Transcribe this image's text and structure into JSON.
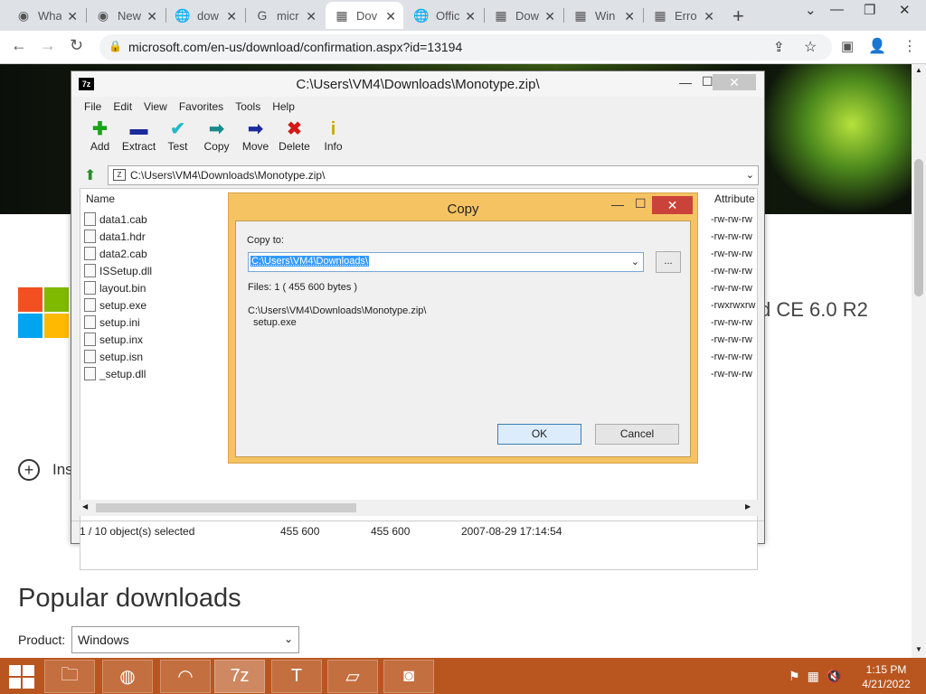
{
  "browser": {
    "tabs": [
      {
        "label": "Wha",
        "icon": "github-icon"
      },
      {
        "label": "New",
        "icon": "github-icon"
      },
      {
        "label": "dow",
        "icon": "globe-icon"
      },
      {
        "label": "micr",
        "icon": "google-icon"
      },
      {
        "label": "Dov",
        "icon": "microsoft-icon",
        "active": true
      },
      {
        "label": "Offic",
        "icon": "globe-icon"
      },
      {
        "label": "Dow",
        "icon": "microsoft-icon"
      },
      {
        "label": "Win",
        "icon": "microsoft-icon"
      },
      {
        "label": "Erro",
        "icon": "microsoft-icon"
      }
    ],
    "url": "microsoft.com/en-us/download/confirmation.aspx?id=13194"
  },
  "page": {
    "title_fragment": "d CE 6.0 R2",
    "install_fragment": "Ins",
    "popular_heading": "Popular downloads",
    "product_label": "Product:",
    "product_value": "Windows",
    "logo_colors": [
      "#f25022",
      "#7fba00",
      "#00a4ef",
      "#ffb900"
    ]
  },
  "sevenzip": {
    "title": "C:\\Users\\VM4\\Downloads\\Monotype.zip\\",
    "menu": [
      "File",
      "Edit",
      "View",
      "Favorites",
      "Tools",
      "Help"
    ],
    "toolbar": [
      {
        "label": "Add",
        "icon": "plus-icon",
        "color": "#1aa31a",
        "glyph": "✚"
      },
      {
        "label": "Extract",
        "icon": "minus-icon",
        "color": "#1b2a9c",
        "glyph": "▬"
      },
      {
        "label": "Test",
        "icon": "check-icon",
        "color": "#26b8c7",
        "glyph": "✔"
      },
      {
        "label": "Copy",
        "icon": "copy-arrow-icon",
        "color": "#1a8a8a",
        "glyph": "➡"
      },
      {
        "label": "Move",
        "icon": "move-arrow-icon",
        "color": "#1b2a9c",
        "glyph": "➡"
      },
      {
        "label": "Delete",
        "icon": "delete-x-icon",
        "color": "#d31818",
        "glyph": "✖"
      },
      {
        "label": "Info",
        "icon": "info-icon",
        "color": "#c8a800",
        "glyph": "i"
      }
    ],
    "path": "C:\\Users\\VM4\\Downloads\\Monotype.zip\\",
    "columns": {
      "name": "Name",
      "attributes": "Attribute"
    },
    "files": [
      {
        "name": "data1.cab",
        "attr": "-rw-rw-rw"
      },
      {
        "name": "data1.hdr",
        "attr": "-rw-rw-rw"
      },
      {
        "name": "data2.cab",
        "attr": "-rw-rw-rw"
      },
      {
        "name": "ISSetup.dll",
        "attr": "-rw-rw-rw"
      },
      {
        "name": "layout.bin",
        "attr": "-rw-rw-rw"
      },
      {
        "name": "setup.exe",
        "attr": "-rwxrwxrw"
      },
      {
        "name": "setup.ini",
        "attr": "-rw-rw-rw"
      },
      {
        "name": "setup.inx",
        "attr": "-rw-rw-rw"
      },
      {
        "name": "setup.isn",
        "attr": "-rw-rw-rw"
      },
      {
        "name": "_setup.dll",
        "attr": "-rw-rw-rw"
      }
    ],
    "status": {
      "selection": "1 / 10 object(s) selected",
      "size": "455 600",
      "packed": "455 600",
      "modified": "2007-08-29 17:14:54"
    }
  },
  "copy_dialog": {
    "title": "Copy",
    "copy_to_label": "Copy to:",
    "copy_to_value": "C:\\Users\\VM4\\Downloads\\",
    "browse_label": "...",
    "files_info": "Files: 1    ( 455 600 bytes )",
    "source_path": "C:\\Users\\VM4\\Downloads\\Monotype.zip\\",
    "source_file": "setup.exe",
    "ok_label": "OK",
    "cancel_label": "Cancel"
  },
  "taskbar": {
    "apps": [
      "file-explorer-icon",
      "chrome-icon",
      "app-swirl-icon",
      "7zip-icon",
      "text-editor-icon",
      "notepad-icon",
      "disk-icon"
    ],
    "time": "1:15 PM",
    "date": "4/21/2022"
  }
}
